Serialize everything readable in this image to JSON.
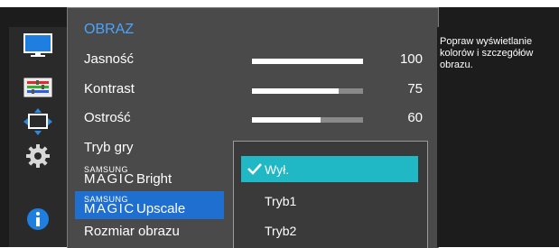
{
  "menu": {
    "title": "OBRAZ",
    "items": [
      {
        "label": "Jasność",
        "value": "100",
        "level": 1.0
      },
      {
        "label": "Kontrast",
        "value": "75",
        "level": 0.78
      },
      {
        "label": "Ostrość",
        "value": "60",
        "level": 0.62
      },
      {
        "label": "Tryb gry"
      },
      {
        "brand_small": "SAMSUNG",
        "brand_big": "MAGIC",
        "label": "Bright"
      },
      {
        "brand_small": "SAMSUNG",
        "brand_big": "MAGIC",
        "label": "Upscale",
        "selected": true
      },
      {
        "label": "Rozmiar obrazu"
      }
    ]
  },
  "dropdown": {
    "options": [
      {
        "label": "Wył.",
        "checked": true
      },
      {
        "label": "Tryb1"
      },
      {
        "label": "Tryb2"
      }
    ]
  },
  "description": "Popraw wyświetlanie kolorów i szczegółów obrazu.",
  "sidebar_icons": [
    "picture-icon",
    "color-icon",
    "size-position-icon",
    "settings-gear-icon",
    "info-icon"
  ],
  "colors": {
    "accent_blue": "#1f6fd1",
    "title_blue": "#4aa3ff",
    "option_highlight": "#21b8c6"
  }
}
